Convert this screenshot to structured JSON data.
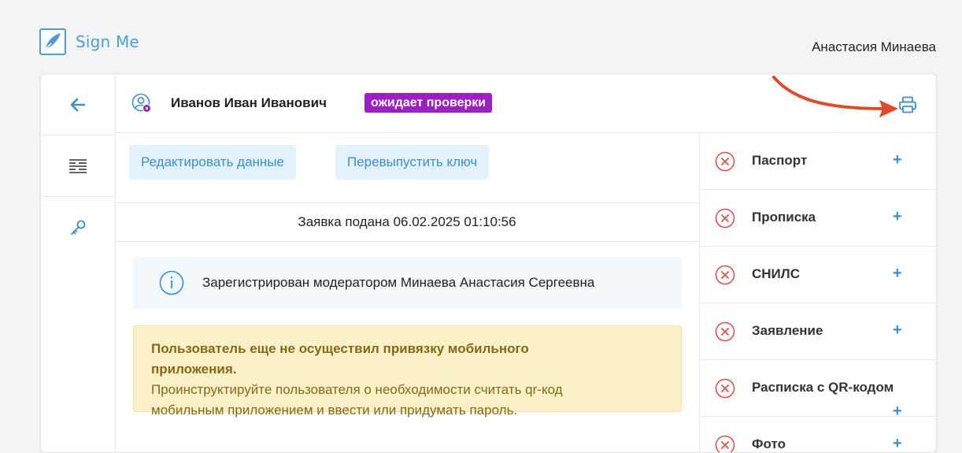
{
  "app": {
    "name": "Sign Me",
    "current_user": "Анастасия Минаева"
  },
  "sidebar": {
    "items": [
      {
        "icon": "back-arrow-icon"
      },
      {
        "icon": "list-icon"
      },
      {
        "icon": "key-icon"
      }
    ]
  },
  "header": {
    "person_name": "Иванов Иван Иванович",
    "status_badge": "ожидает проверки",
    "print_icon": "printer-icon"
  },
  "actions": {
    "edit_label": "Редактировать данные",
    "reissue_label": "Перевыпустить ключ"
  },
  "submitted": "Заявка подана 06.02.2025 01:10:56",
  "info": {
    "text": "Зарегистрирован модератором Минаева Анастасия Сергеевна"
  },
  "warning": {
    "title": "Пользователь еще не осуществил привязку мобильного",
    "title_line2": "приложения.",
    "body_line1": "Проинструктируйте пользователя о необходимости считать qr-код",
    "body_line2": "мобильным приложением и ввести или придумать пароль."
  },
  "documents": [
    {
      "label": "Паспорт",
      "plus": "+"
    },
    {
      "label": "Прописка",
      "plus": "+"
    },
    {
      "label": "СНИЛС",
      "plus": "+"
    },
    {
      "label": "Заявление",
      "plus": "+"
    },
    {
      "label": "Расписка с QR-кодом",
      "plus": "+"
    },
    {
      "label": "Фото",
      "plus": "+"
    }
  ],
  "colors": {
    "accent": "#3b8fcf",
    "badge": "#9c1fc4",
    "error": "#d9534f",
    "warning_bg": "#fcf0c8",
    "warning_text": "#866818",
    "annotation_arrow": "#e04a2a"
  }
}
